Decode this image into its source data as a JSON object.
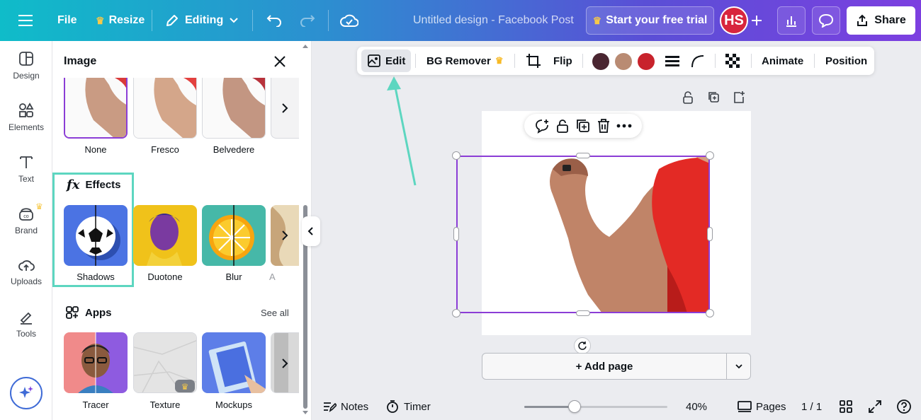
{
  "topbar": {
    "file": "File",
    "resize": "Resize",
    "editing": "Editing",
    "title": "Untitled design - Facebook Post",
    "trial": "Start your free trial",
    "avatar": "HS",
    "share": "Share"
  },
  "rail": {
    "items": [
      {
        "label": "Design",
        "icon": "design-icon"
      },
      {
        "label": "Elements",
        "icon": "elements-icon"
      },
      {
        "label": "Text",
        "icon": "text-icon"
      },
      {
        "label": "Brand",
        "icon": "brand-icon"
      },
      {
        "label": "Uploads",
        "icon": "uploads-icon"
      },
      {
        "label": "Tools",
        "icon": "tools-icon"
      }
    ]
  },
  "panel": {
    "title": "Image",
    "filters": [
      {
        "label": "None"
      },
      {
        "label": "Fresco"
      },
      {
        "label": "Belvedere"
      }
    ],
    "effects_title": "Effects",
    "effects": [
      {
        "label": "Shadows"
      },
      {
        "label": "Duotone"
      },
      {
        "label": "Blur"
      },
      {
        "label": "A"
      }
    ],
    "apps_title": "Apps",
    "apps_see_all": "See all",
    "apps": [
      {
        "label": "Tracer"
      },
      {
        "label": "Texture"
      },
      {
        "label": "Mockups"
      }
    ]
  },
  "context_toolbar": {
    "edit": "Edit",
    "bg_remover": "BG Remover",
    "flip": "Flip",
    "animate": "Animate",
    "position": "Position",
    "swatches": [
      "#4a2631",
      "#b98b73",
      "#c8232c"
    ]
  },
  "canvas": {
    "add_page": "+ Add page"
  },
  "footer": {
    "notes": "Notes",
    "timer": "Timer",
    "zoom": "40%",
    "zoom_level": 0.35,
    "pages": "Pages",
    "page_count": "1 / 1"
  },
  "colors": {
    "accent_purple": "#8b3dd6",
    "highlight": "#5dd6c0",
    "avatar": "#d8253d"
  }
}
